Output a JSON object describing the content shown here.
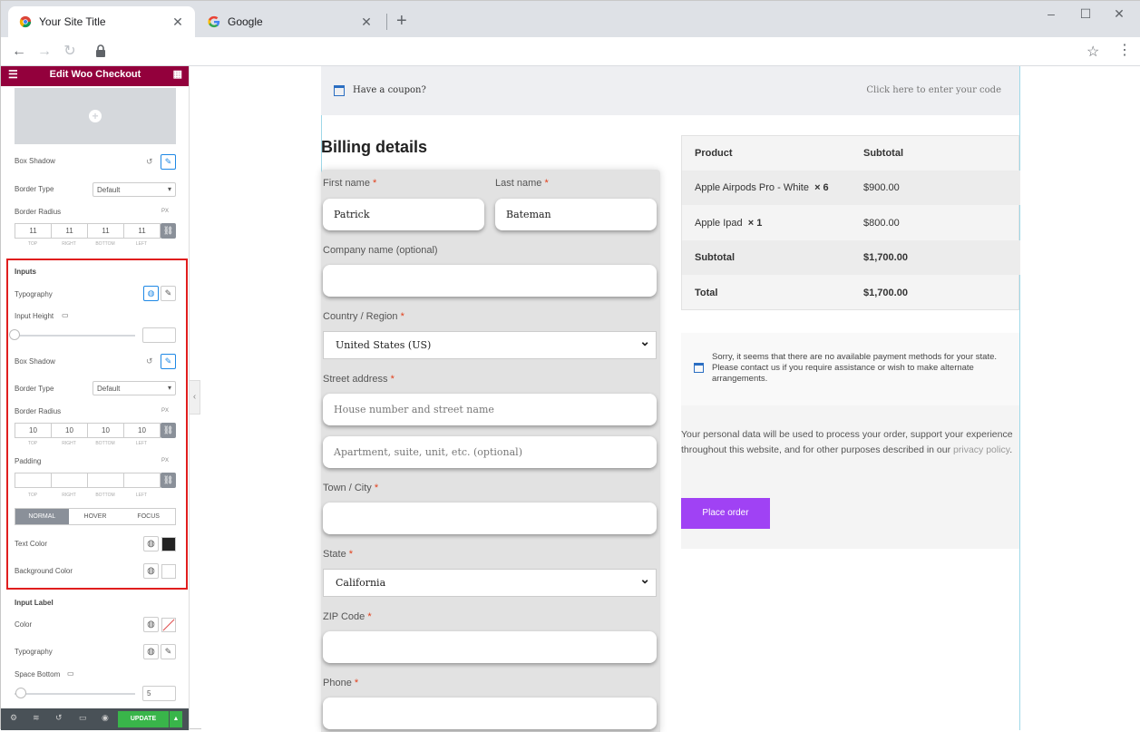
{
  "browser": {
    "tabs": [
      {
        "title": "Your Site Title",
        "active": true
      },
      {
        "title": "Google",
        "active": false
      }
    ],
    "new_tab": "+",
    "close_glyph": "✕"
  },
  "sidebar": {
    "header_title": "Edit Woo Checkout",
    "pre": {
      "box_shadow_label": "Box Shadow",
      "border_type_label": "Border Type",
      "border_type_value": "Default",
      "border_radius_label": "Border Radius",
      "unit": "PX",
      "radius_values": [
        "11",
        "11",
        "11",
        "11"
      ]
    },
    "side_labels": [
      "TOP",
      "RIGHT",
      "BOTTOM",
      "LEFT"
    ],
    "inputs": {
      "section_title": "Inputs",
      "typography_label": "Typography",
      "input_height_label": "Input Height",
      "box_shadow_label": "Box Shadow",
      "border_type_label": "Border Type",
      "border_type_value": "Default",
      "border_radius_label": "Border Radius",
      "unit": "PX",
      "radius_values": [
        "10",
        "10",
        "10",
        "10"
      ],
      "padding_label": "Padding",
      "padding_values": [
        "",
        "",
        "",
        ""
      ],
      "state_tabs": [
        "NORMAL",
        "HOVER",
        "FOCUS"
      ],
      "text_color_label": "Text Color",
      "text_color": "#222222",
      "background_color_label": "Background Color",
      "background_color": "#ffffff"
    },
    "input_label": {
      "section_title": "Input Label",
      "color_label": "Color",
      "typography_label": "Typography",
      "space_bottom_label": "Space Bottom",
      "space_bottom_value": "5"
    },
    "footer": {
      "update_label": "UPDATE"
    },
    "accent": "#93003c"
  },
  "page": {
    "coupon_text": "Have a coupon?",
    "coupon_link": "Click here to enter your code",
    "billing_title": "Billing details",
    "required_mark": "*",
    "fields": {
      "first_name_label": "First name",
      "first_name_value": "Patrick",
      "last_name_label": "Last name",
      "last_name_value": "Bateman",
      "company_label": "Company name (optional)",
      "country_label": "Country / Region",
      "country_value": "United States (US)",
      "street_label": "Street address",
      "street_placeholder": "House number and street name",
      "street2_placeholder": "Apartment, suite, unit, etc. (optional)",
      "city_label": "Town / City",
      "state_label": "State",
      "state_value": "California",
      "zip_label": "ZIP Code",
      "phone_label": "Phone"
    },
    "order": {
      "head_product": "Product",
      "head_subtotal": "Subtotal",
      "rows": [
        {
          "product": "Apple Airpods Pro - White",
          "qty": "× 6",
          "amount": "$900.00"
        },
        {
          "product": "Apple Ipad",
          "qty": "× 1",
          "amount": "$800.00"
        }
      ],
      "subtotal_label": "Subtotal",
      "subtotal_value": "$1,700.00",
      "total_label": "Total",
      "total_value": "$1,700.00"
    },
    "payment_message": "Sorry, it seems that there are no available payment methods for your state. Please contact us if you require assistance or wish to make alternate arrangements.",
    "privacy_text": "Your personal data will be used to process your order, support your experience throughout this website, and for other purposes described in our",
    "privacy_link": "privacy policy",
    "privacy_end": ".",
    "place_order_label": "Place order",
    "place_order_color": "#a042f4"
  }
}
